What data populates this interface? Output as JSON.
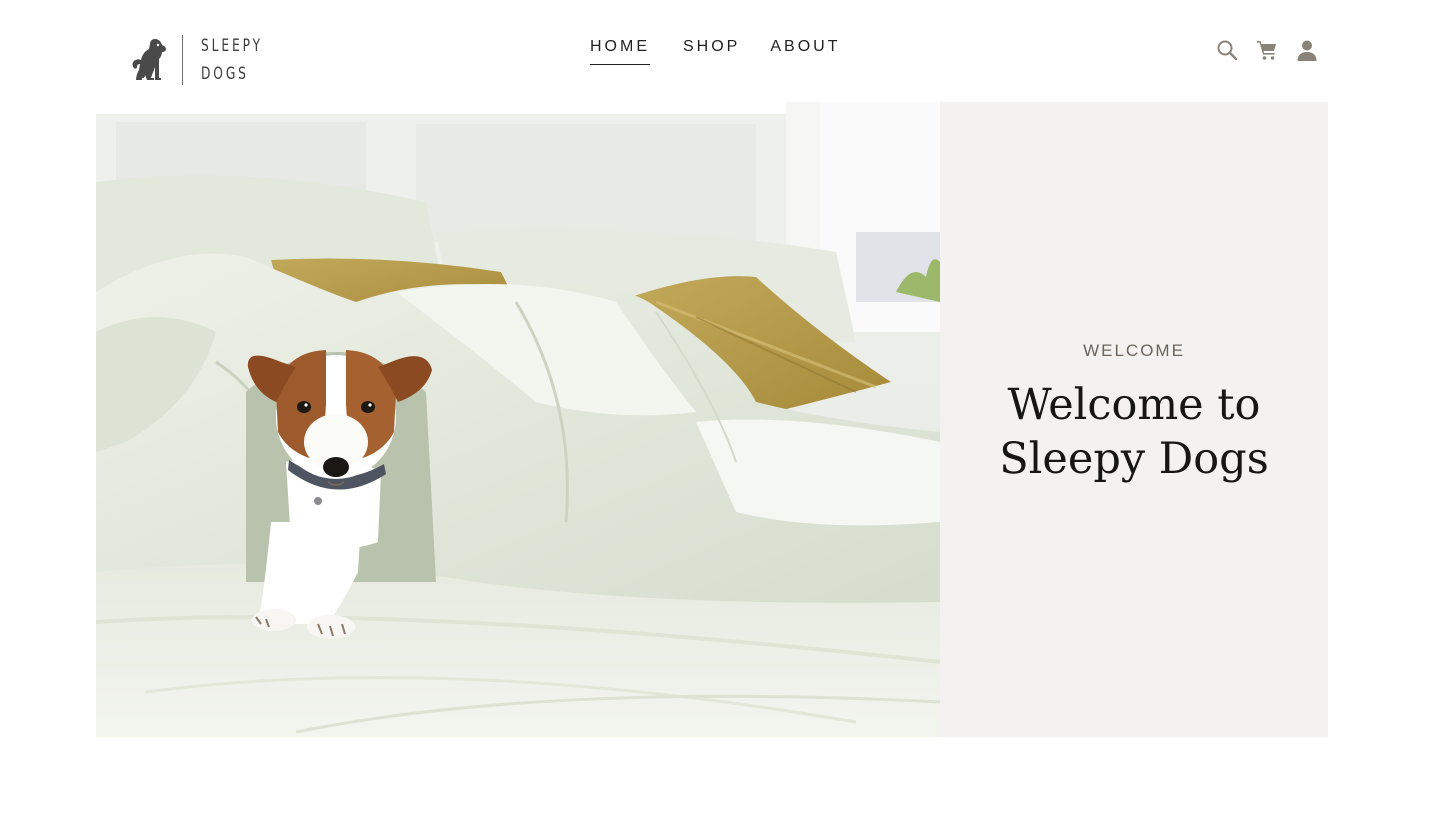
{
  "brand": {
    "name_line1": "SLEEPY",
    "name_line2": "DOGS",
    "logo_icon": "sitting-dog-icon"
  },
  "nav": {
    "items": [
      {
        "label": "HOME",
        "active": true
      },
      {
        "label": "SHOP",
        "active": false
      },
      {
        "label": "ABOUT",
        "active": false
      }
    ]
  },
  "header_icons": {
    "search": "search-icon",
    "cart": "cart-icon",
    "account": "user-icon"
  },
  "hero": {
    "image_subject": "Jack Russell terrier lying in a white duvet on a bed with olive pillows",
    "eyebrow": "WELCOME",
    "title_line1": "Welcome to",
    "title_line2": "Sleepy Dogs"
  },
  "colors": {
    "panel_bg": "#f3f2f0",
    "text_dark": "#161616",
    "eyebrow": "#6d655c",
    "icon": "#8a837a"
  }
}
